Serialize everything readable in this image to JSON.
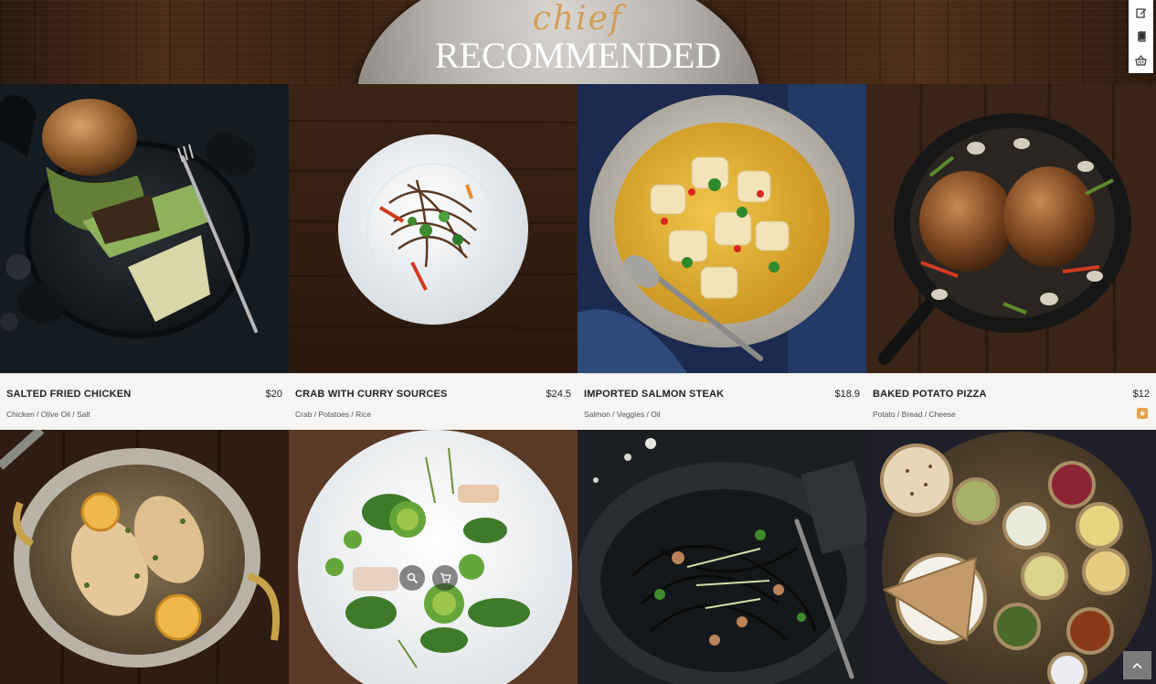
{
  "header": {
    "script_text": "chief",
    "title": "RECOMMENDED"
  },
  "side_toolbar": {
    "items": [
      {
        "icon": "edit-icon"
      },
      {
        "icon": "book-icon"
      },
      {
        "icon": "basket-icon"
      }
    ]
  },
  "dishes": [
    {
      "name": "SALTED FRIED CHICKEN",
      "price": "$20",
      "ingredients": "Chicken / Olive Oil / Salt"
    },
    {
      "name": "CRAB WITH CURRY SOURCES",
      "price": "$24.5",
      "ingredients": "Crab / Potatoes / Rice"
    },
    {
      "name": "IMPORTED SALMON STEAK",
      "price": "$18.9",
      "ingredients": "Salmon / Veggies / Oil"
    },
    {
      "name": "BAKED POTATO PIZZA",
      "price": "$12",
      "ingredients": "Potato / Bread / Cheese",
      "badge": "star-icon"
    }
  ],
  "colors": {
    "accent": "#e3a34a",
    "info_bg": "#f6f5f3",
    "scroll_button": "#7b7b7b"
  }
}
